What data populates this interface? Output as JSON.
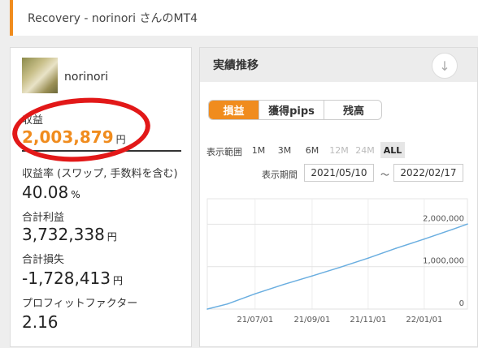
{
  "header": {
    "title": "Recovery - norinori さんのMT4"
  },
  "profile": {
    "username": "norinori"
  },
  "stats": [
    {
      "label": "収益",
      "value": "2,003,879",
      "unit": "円"
    },
    {
      "label": "収益率 (スワップ, 手数料を含む)",
      "value": "40.08",
      "unit": "%"
    },
    {
      "label": "合計利益",
      "value": "3,732,338",
      "unit": "円"
    },
    {
      "label": "合計損失",
      "value": "-1,728,413",
      "unit": "円"
    },
    {
      "label": "プロフィットファクター",
      "value": "2.16",
      "unit": ""
    }
  ],
  "panel": {
    "title": "実績推移",
    "tabs": [
      "損益",
      "獲得pips",
      "残高"
    ],
    "range_label": "表示範囲",
    "ranges": [
      "1M",
      "3M",
      "6M",
      "12M",
      "24M",
      "ALL"
    ],
    "period_label": "表示期間",
    "date_from": "2021/05/10",
    "date_to": "2022/02/17",
    "tilde": "～"
  },
  "chart_data": {
    "type": "line",
    "x_tick_labels": [
      "21/07/01",
      "21/09/01",
      "21/11/01",
      "22/01/01"
    ],
    "y_tick_labels": [
      "2,000,000",
      "1,000,000",
      "0"
    ],
    "ylim": [
      0,
      2600000
    ],
    "x": [
      "2021-05-10",
      "2021-06-01",
      "2021-07-01",
      "2021-08-01",
      "2021-09-01",
      "2021-10-01",
      "2021-11-01",
      "2021-12-01",
      "2022-01-01",
      "2022-02-01",
      "2022-02-17"
    ],
    "series": [
      {
        "values": [
          0,
          120000,
          360000,
          580000,
          780000,
          980000,
          1200000,
          1430000,
          1650000,
          1880000,
          2003879
        ],
        "color": "#6aaee0"
      }
    ],
    "grid": true,
    "accent": "#f08c1e"
  }
}
